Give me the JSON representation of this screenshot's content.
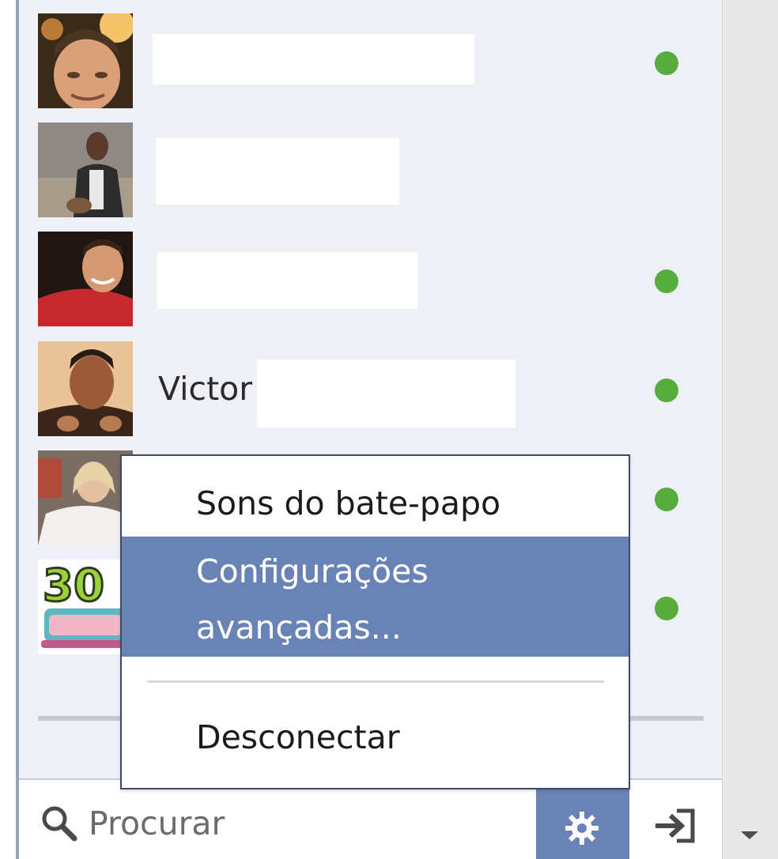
{
  "friends": [
    {
      "id": "friend-1",
      "name_visible": "",
      "online": true
    },
    {
      "id": "friend-2",
      "name_visible": "",
      "online": false
    },
    {
      "id": "friend-3",
      "name_visible": "",
      "online": true
    },
    {
      "id": "friend-4",
      "name_visible": "Victor",
      "online": true
    },
    {
      "id": "friend-5",
      "name_visible": "",
      "online": true
    },
    {
      "id": "friend-6",
      "name_visible": "",
      "online": true
    }
  ],
  "menu": {
    "items": [
      {
        "label": "Sons do bate-papo",
        "highlighted": false
      },
      {
        "label_line1": "Configurações",
        "label_line2": "avançadas...",
        "highlighted": true
      },
      {
        "label": "Desconectar",
        "highlighted": false
      }
    ]
  },
  "search": {
    "placeholder": "Procurar"
  },
  "icons": {
    "search": "search-icon",
    "settings": "gear-icon",
    "signin": "sign-in-icon",
    "scroll_down": "chevron-down-icon",
    "online": "online-dot-icon"
  },
  "colors": {
    "panel_bg": "#eef0f6",
    "online": "#56ad3e",
    "menu_highlight": "#6a83b6",
    "settings_button": "#6a83b6"
  }
}
